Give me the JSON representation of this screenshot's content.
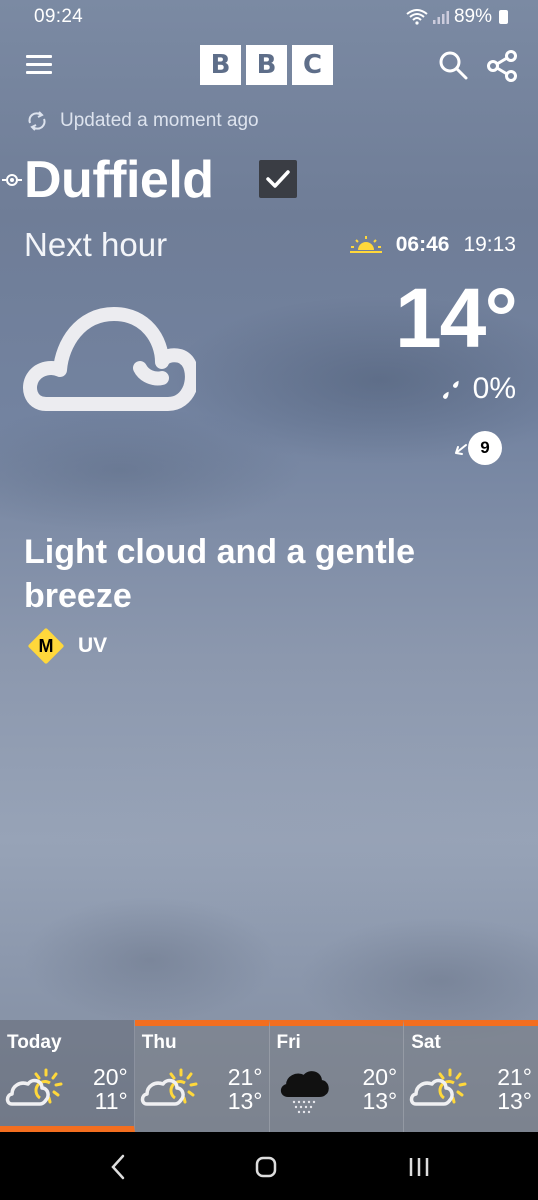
{
  "status": {
    "time": "09:24",
    "battery": "89%"
  },
  "header": {
    "logo": [
      "B",
      "B",
      "C"
    ]
  },
  "updated": "Updated a moment ago",
  "location": "Duffield",
  "period": "Next hour",
  "sun": {
    "sunrise": "06:46",
    "sunset": "19:13"
  },
  "current": {
    "temperature": "14°",
    "rain_chance": "0%",
    "wind_speed": "9",
    "description": "Light cloud and a gentle breeze",
    "uv_level": "M",
    "uv_label": "UV"
  },
  "forecast": [
    {
      "day": "Today",
      "high": "20°",
      "low": "11°",
      "icon": "light-cloud-sun-icon"
    },
    {
      "day": "Thu",
      "high": "21°",
      "low": "13°",
      "icon": "light-cloud-sun-icon"
    },
    {
      "day": "Fri",
      "high": "20°",
      "low": "13°",
      "icon": "drizzle-cloud-icon"
    },
    {
      "day": "Sat",
      "high": "21°",
      "low": "13°",
      "icon": "light-cloud-sun-icon"
    }
  ],
  "colors": {
    "accent": "#f36e1f",
    "uv_yellow": "#ffd83b"
  }
}
